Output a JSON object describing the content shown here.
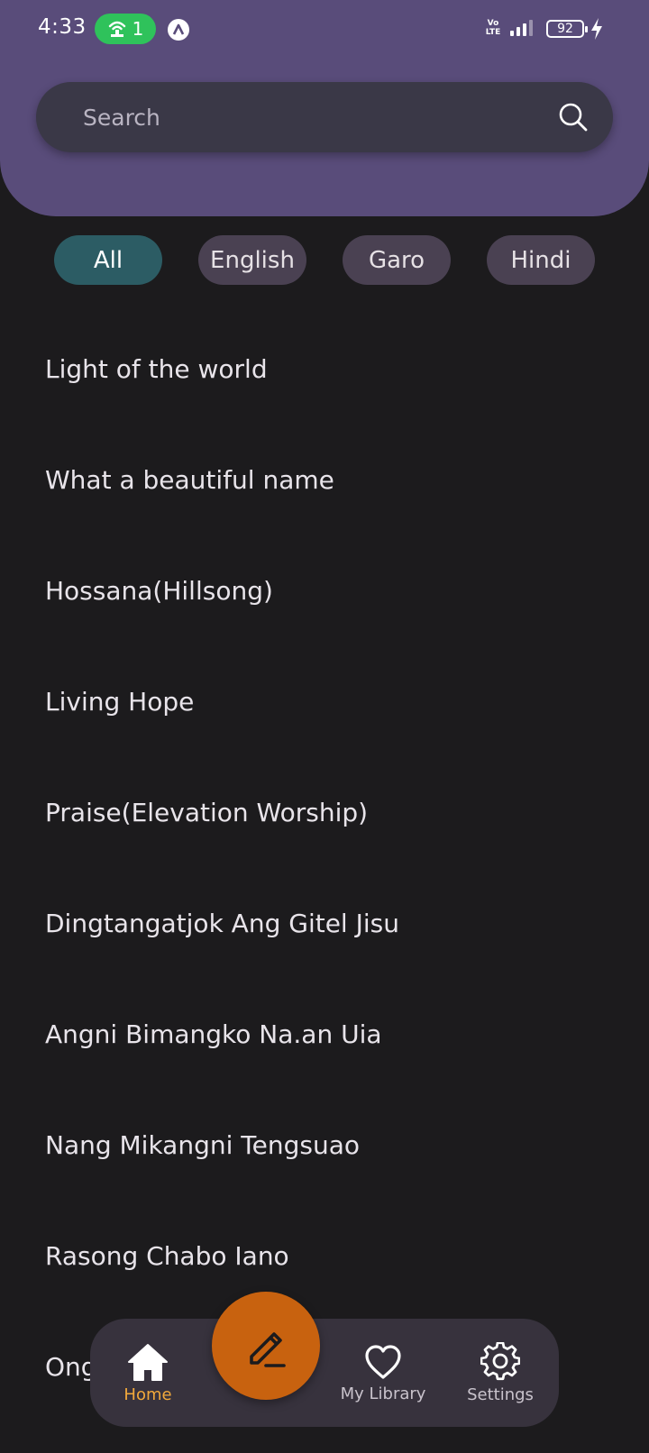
{
  "status_bar": {
    "time": "4:33",
    "hotspot_count": "1",
    "volte": "Vo\nLTE",
    "battery": "92"
  },
  "search": {
    "placeholder": "Search"
  },
  "filters": [
    {
      "label": "All",
      "active": true
    },
    {
      "label": "English",
      "active": false
    },
    {
      "label": "Garo",
      "active": false
    },
    {
      "label": "Hindi",
      "active": false
    }
  ],
  "songs": [
    "Light of the world",
    "What a beautiful name",
    "Hossana(Hillsong)",
    "Living Hope",
    "Praise(Elevation Worship)",
    "Dingtangatjok Ang Gitel Jisu",
    "Angni Bimangko Na.an Uia",
    "Nang Mikangni Tengsuao",
    "Rasong Chabo Iano",
    "Ong"
  ],
  "bottom_nav": {
    "home": {
      "label": "Home",
      "icon": "home-icon"
    },
    "compose": {
      "icon": "pencil-icon"
    },
    "library": {
      "label": "My Library",
      "icon": "heart-icon"
    },
    "settings": {
      "label": "Settings",
      "icon": "gear-icon"
    }
  },
  "colors": {
    "header": "#594c7a",
    "background": "#1c1b1d",
    "active_chip": "#2c5c64",
    "chip": "#4a4152",
    "fab": "#c8620f",
    "active_nav": "#f2a93b"
  }
}
